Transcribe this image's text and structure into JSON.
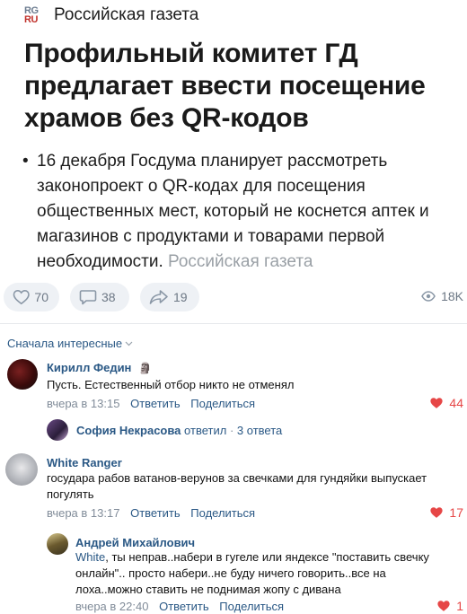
{
  "source": {
    "logo_line1": "RG",
    "logo_line2": "RU",
    "name": "Российская газета"
  },
  "article": {
    "headline": "Профильный комитет ГД предлагает ввести посещение храмов без QR-кодов",
    "bullet": "16 декабря Госдума планирует рассмотреть законопроект о QR-кодах для посещения общественных мест, который не коснется аптек и магазинов с продуктами и товарами первой необходимости.",
    "bullet_source": "Российская газета"
  },
  "actions": {
    "likes": "70",
    "comments": "38",
    "shares": "19",
    "views": "18K"
  },
  "comments_section": {
    "sort_label": "Сначала интересные"
  },
  "comments": [
    {
      "author": "Кирилл Федин",
      "badge": "🗿",
      "text": "Пусть. Естественный отбор никто не отменял",
      "time": "вчера в 13:15",
      "reply_label": "Ответить",
      "share_label": "Поделиться",
      "likes": "44",
      "thread": {
        "author": "София Некрасова",
        "action": "ответил",
        "sep": "·",
        "count": "3 ответа"
      }
    },
    {
      "author": "White Ranger",
      "text": "государа рабов ватанов-верунов за свечками для гундяйки выпускает погулять",
      "time": "вчера в 13:17",
      "reply_label": "Ответить",
      "share_label": "Поделиться",
      "likes": "17"
    },
    {
      "author": "Андрей Михайлович",
      "reply_to": "White",
      "text": ", ты неправ..набери в гугеле или яндексе \"поставить свечку онлайн\".. просто набери..не буду ничего говорить..все на лоха..можно ставить не поднимая жопу с дивана",
      "time": "вчера в 22:40",
      "reply_label": "Ответить",
      "share_label": "Поделиться",
      "likes": "1"
    }
  ],
  "colors": {
    "link": "#2a5885",
    "muted": "#818c99",
    "like_red": "#e64646",
    "pill_bg": "#eef1f5"
  },
  "icons": [
    "heart-icon",
    "comment-icon",
    "share-icon",
    "eye-icon",
    "chevron-down-icon"
  ]
}
